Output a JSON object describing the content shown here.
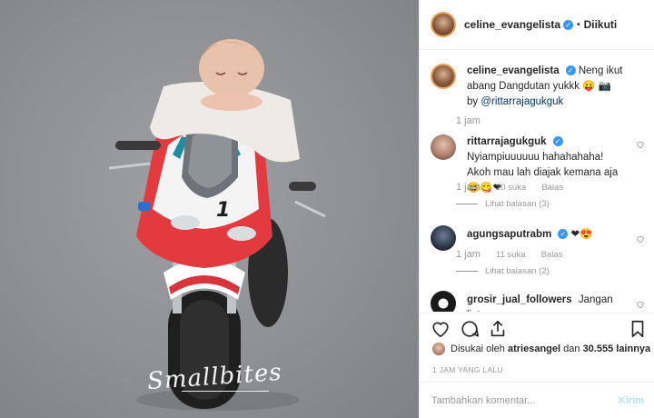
{
  "photo": {
    "signature": "Smallbites",
    "bike_number": "1"
  },
  "header": {
    "username": "celine_evangelista",
    "separator": "•",
    "follow_status": "Diikuti"
  },
  "caption": {
    "username": "celine_evangelista",
    "text_part1": "Neng ikut abang Dangdutan yukkk 😛 📷 by",
    "mention": "@rittarrajagukguk",
    "time": "1 jam"
  },
  "comments": [
    {
      "username": "rittarrajagukguk",
      "text": "Nyiampiuuuuuu hahahahaha! Akoh mau lah diajak kemana aja 😆😋❤",
      "time": "1 jam",
      "likes": "20 suka",
      "reply_label": "Balas",
      "view_replies": "Lihat balasan (3)"
    },
    {
      "username": "agungsaputrabm",
      "text": "❤😍",
      "time": "1 jam",
      "likes": "11 suka",
      "reply_label": "Balas",
      "view_replies": "Lihat balasan (2)"
    },
    {
      "username": "grosir_jual_followers",
      "text": "Jangan liat"
    }
  ],
  "likes": {
    "prefix": "Disukai oleh",
    "user": "atriesangel",
    "middle": "dan",
    "count": "30.555 lainnya"
  },
  "post_time": "1 JAM YANG LALU",
  "add_comment": {
    "placeholder": "Tambahkan komentar...",
    "send_label": "Kirim"
  },
  "colors": {
    "verified": "#3897f0",
    "link": "#003569",
    "muted": "#999999",
    "send_disabled": "#b2dffc",
    "bike_red": "#d8343c"
  }
}
